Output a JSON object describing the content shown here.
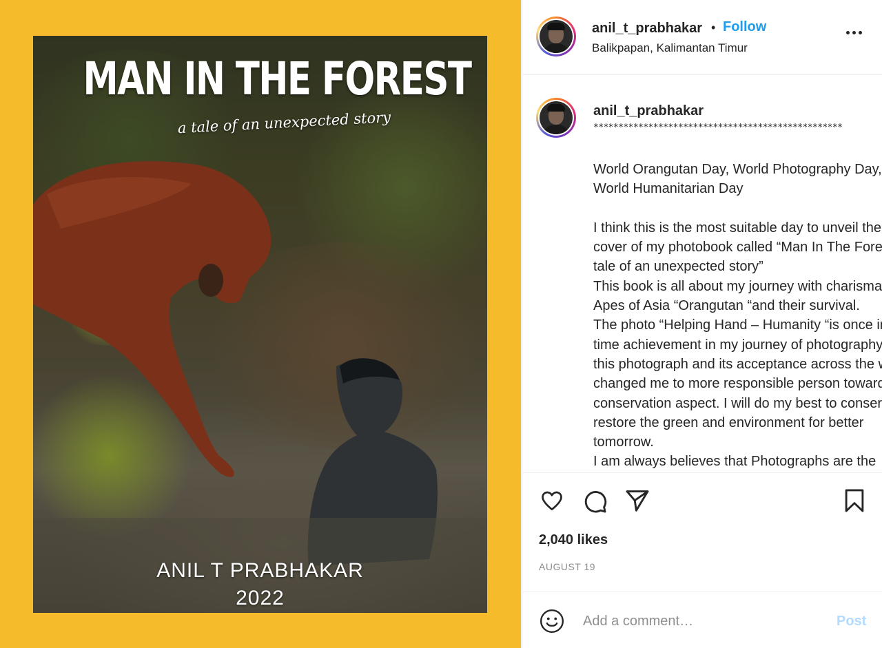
{
  "post_media": {
    "cover_title": "MAN IN THE FOREST",
    "cover_subtitle": "a tale of an unexpected story",
    "cover_author": "ANIL T PRABHAKAR",
    "cover_year": "2022"
  },
  "header": {
    "username": "anil_t_prabhakar",
    "separator": "•",
    "follow_label": "Follow",
    "location": "Balikpapan, Kalimantan Timur"
  },
  "caption": {
    "username": "anil_t_prabhakar",
    "stars": "**************************************************",
    "text": "World Orangutan Day, World Photography Day,\nWorld Humanitarian Day\n\nI think this is the most suitable day to unveil the\ncover of my photobook called “Man In The Forest – a\ntale of an unexpected story”\nThis book is all about my journey with charismatic\nApes of Asia “Orangutan “and their survival.\nThe photo “Helping Hand – Humanity “is once in a life\ntime achievement in my journey of photography and\nthis photograph and its acceptance across the world\nchanged me to more responsible person towards\nconservation aspect. I will do my best to conserve and\nrestore the green and environment for better\ntomorrow.\nI am always believes that Photographs are the"
  },
  "actions": {
    "like_icon": "heart-icon",
    "comment_icon": "comment-icon",
    "share_icon": "send-icon",
    "save_icon": "bookmark-icon"
  },
  "stats": {
    "likes": "2,040 likes",
    "date": "AUGUST 19"
  },
  "comment_box": {
    "emoji_icon": "smiley-icon",
    "placeholder": "Add a comment…",
    "post_label": "Post"
  },
  "colors": {
    "media_background": "#f6bb2a",
    "follow_blue": "#1e9df0",
    "post_disabled": "#b3dbff"
  }
}
